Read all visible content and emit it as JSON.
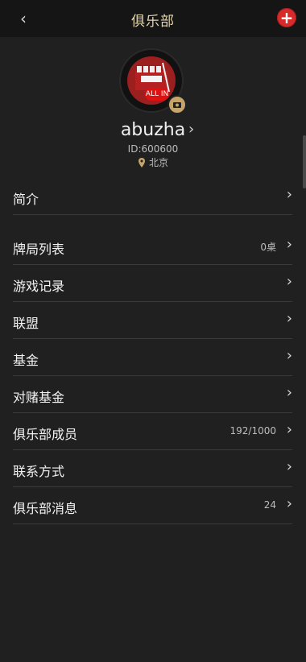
{
  "header": {
    "title": "俱乐部"
  },
  "profile": {
    "name": "abuzha",
    "id_label": "ID:600600",
    "location": "北京"
  },
  "menu": {
    "items": [
      {
        "label": "简介",
        "value": ""
      },
      {
        "label": "牌局列表",
        "value": "0桌"
      },
      {
        "label": "游戏记录",
        "value": ""
      },
      {
        "label": "联盟",
        "value": ""
      },
      {
        "label": "基金",
        "value": ""
      },
      {
        "label": "对赌基金",
        "value": ""
      },
      {
        "label": "俱乐部成员",
        "value": "192/1000"
      },
      {
        "label": "联系方式",
        "value": ""
      },
      {
        "label": "俱乐部消息",
        "value": "24"
      }
    ]
  }
}
